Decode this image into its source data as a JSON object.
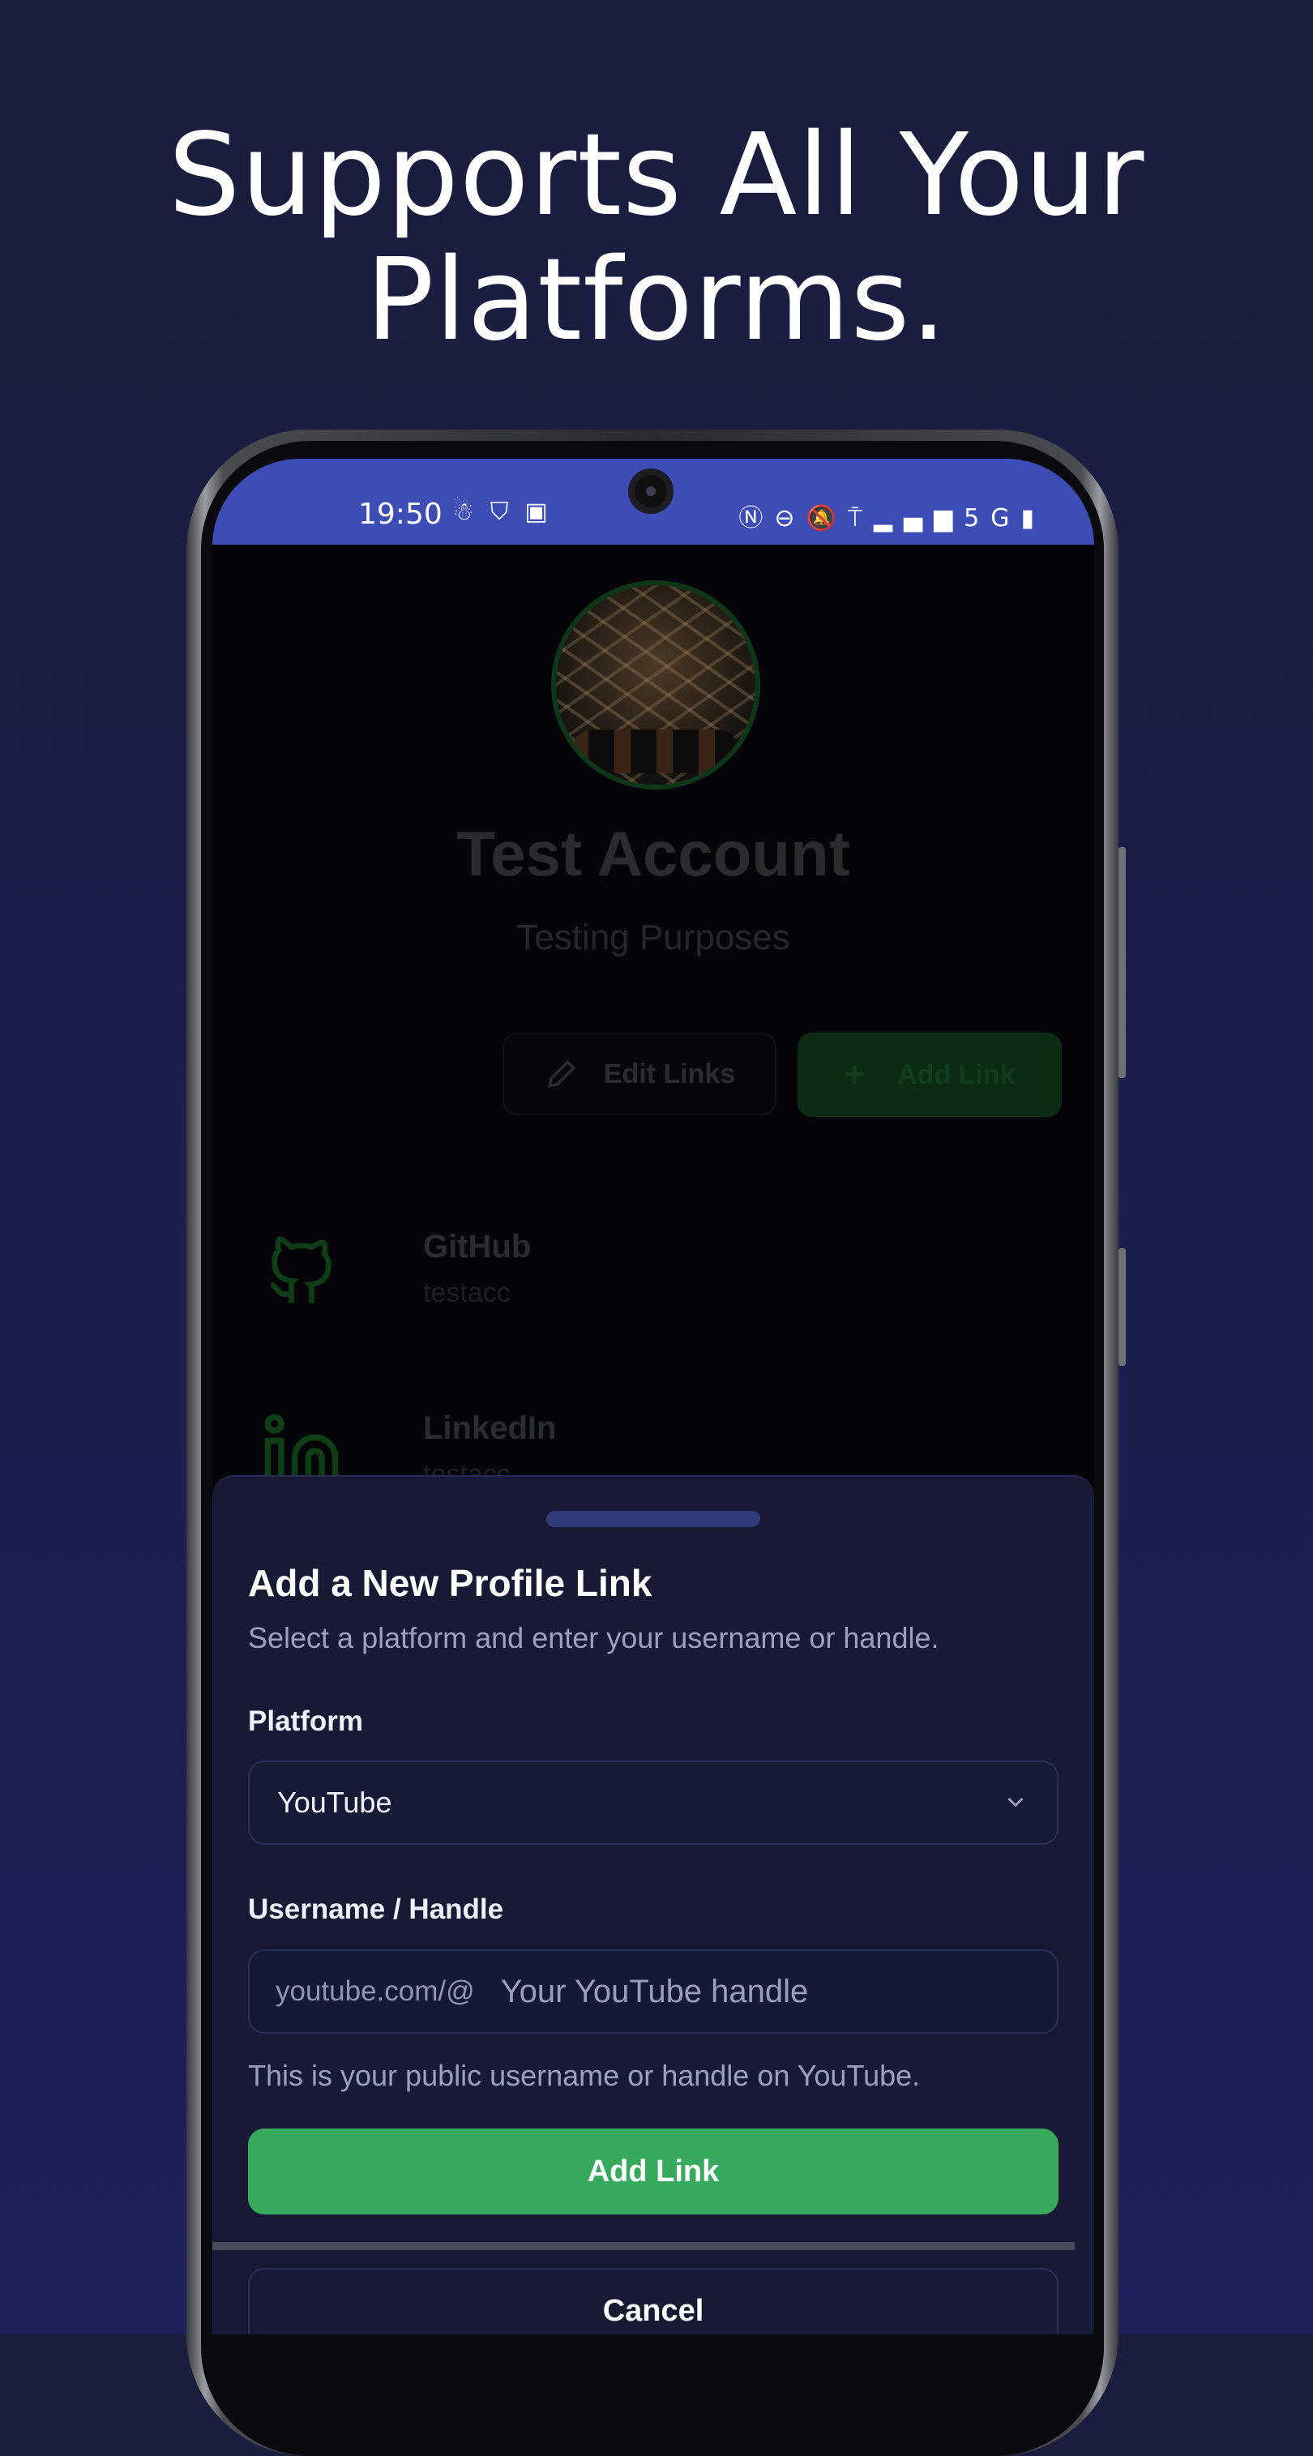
{
  "headline": {
    "line1": "Supports All Your",
    "line2": "Platforms."
  },
  "statusbar": {
    "time": "19:50",
    "left_icons": [
      "notification-icon",
      "shield-icon",
      "image-icon"
    ],
    "right_icons": [
      "nfc-icon",
      "do-not-disturb-icon",
      "bell-off-icon",
      "hotspot-icon",
      "signal-icon",
      "battery-icon"
    ],
    "network": "5G"
  },
  "profile": {
    "name": "Test Account",
    "subtitle": "Testing Purposes",
    "edit_button": "Edit Links",
    "add_button": "Add Link"
  },
  "links": [
    {
      "title": "GitHub",
      "handle": "testacc",
      "icon": "github-icon"
    },
    {
      "title": "LinkedIn",
      "handle": "testacc",
      "icon": "linkedin-icon"
    }
  ],
  "sheet": {
    "title": "Add a New Profile Link",
    "description": "Select a platform and enter your username or handle.",
    "platform_label": "Platform",
    "platform_value": "YouTube",
    "username_label": "Username / Handle",
    "username_prefix": "youtube.com/@",
    "username_placeholder": "Your YouTube handle",
    "hint": "This is your public username or handle on YouTube.",
    "submit_button": "Add Link",
    "cancel_button": "Cancel"
  },
  "colors": {
    "background": "#1b1f4e",
    "statusbar": "#3e4db6",
    "sheet": "#181a35",
    "primary": "#37aa5e"
  }
}
